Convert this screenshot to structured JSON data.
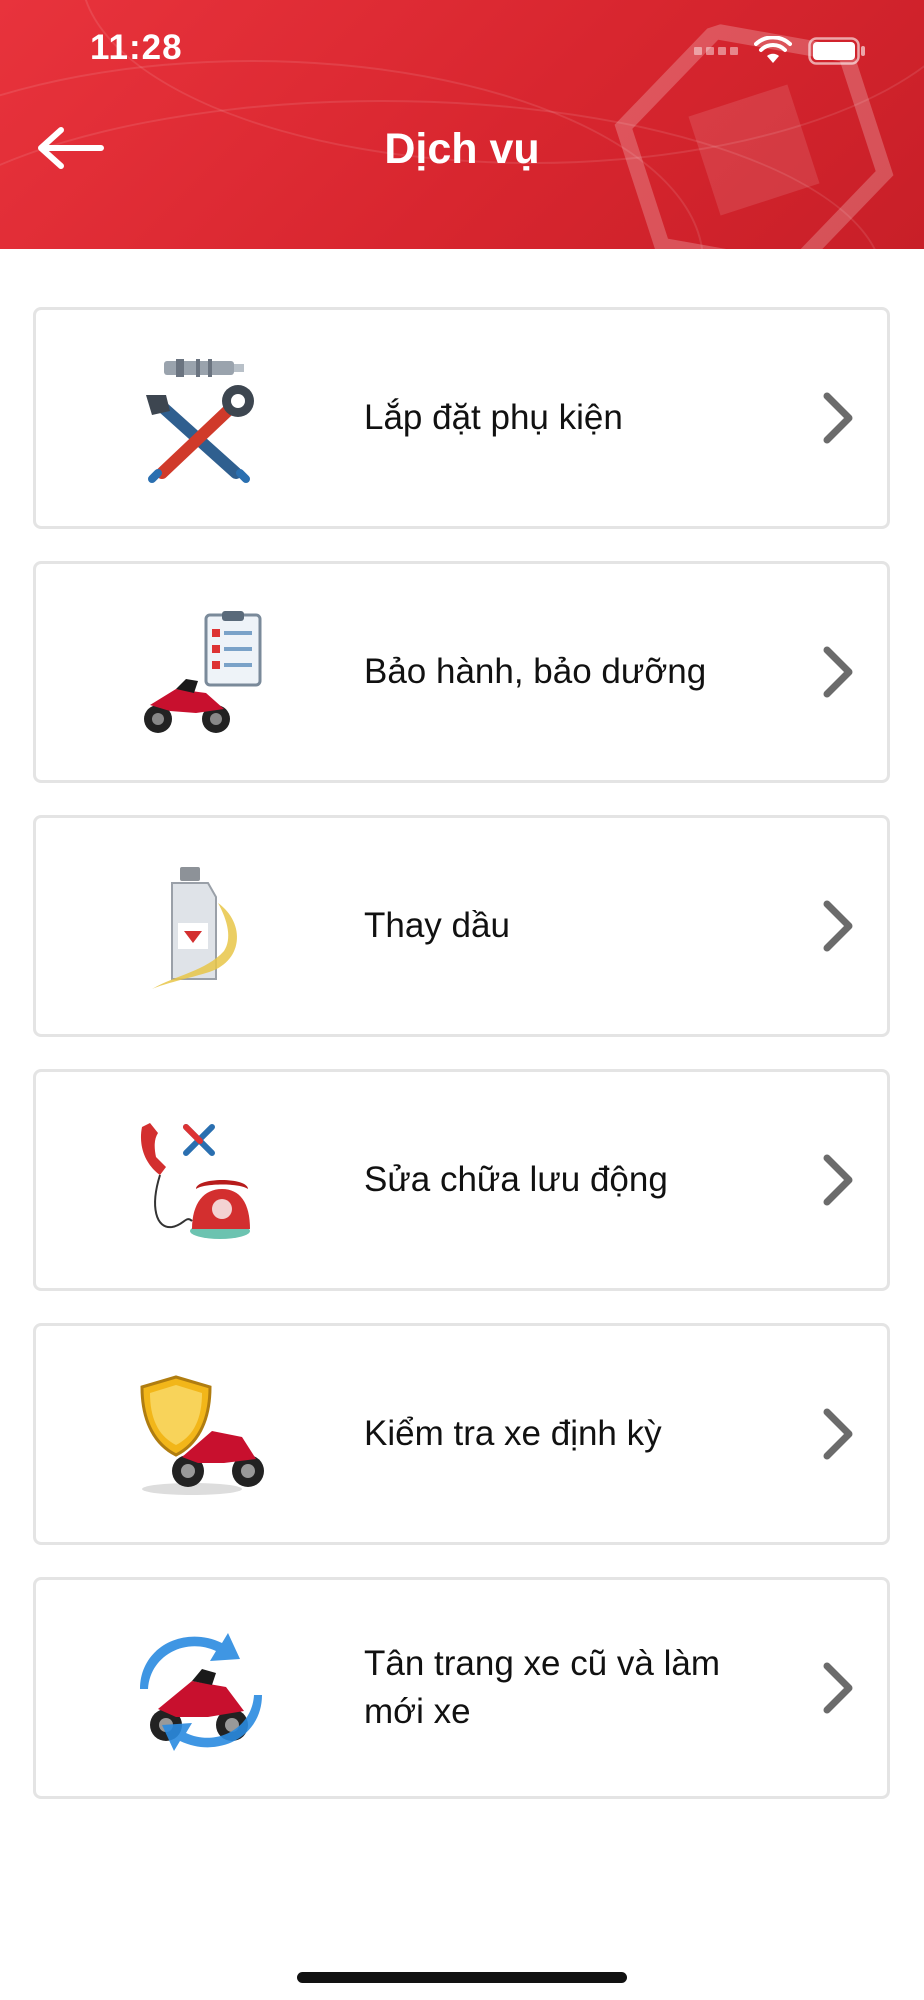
{
  "status_bar": {
    "time": "11:28"
  },
  "header": {
    "title": "Dịch vụ",
    "back_icon": "arrow-left-icon"
  },
  "services": [
    {
      "label": "Lắp đặt phụ kiện",
      "icon": "tools-icon"
    },
    {
      "label": "Bảo hành, bảo dưỡng",
      "icon": "motorbike-checklist-icon"
    },
    {
      "label": "Thay dầu",
      "icon": "oil-bottle-icon"
    },
    {
      "label": "Sửa chữa lưu động",
      "icon": "phone-repair-icon"
    },
    {
      "label": "Kiểm tra xe định kỳ",
      "icon": "shield-motorbike-icon"
    },
    {
      "label": "Tân trang xe cũ và làm mới xe",
      "icon": "refresh-motorbike-icon"
    }
  ],
  "colors": {
    "header": "#e32d36",
    "card_border": "#e4e4e4",
    "chevron": "#6b6b6b"
  }
}
